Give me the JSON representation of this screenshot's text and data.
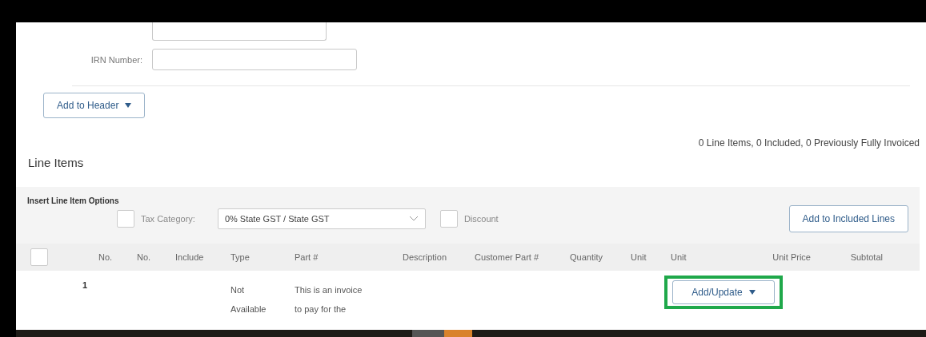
{
  "header_form": {
    "irn_label": "IRN Number:",
    "add_to_header": "Add to Header"
  },
  "line_items": {
    "title": "Line Items",
    "summary": "0 Line Items,  0 Included,  0 Previously Fully Invoiced"
  },
  "insert_options": {
    "title": "Insert Line Item Options",
    "tax_category": {
      "checked": false,
      "label": "Tax Category:",
      "value": "0% State GST / State GST"
    },
    "discount": {
      "checked": false,
      "label": "Discount"
    },
    "add_button": "Add to Included Lines"
  },
  "table": {
    "select_all_checked": false,
    "columns": [
      "No.",
      "No.",
      "Include",
      "Type",
      "Part #",
      "Description",
      "Customer Part #",
      "Quantity",
      "Unit",
      "Unit",
      "Unit Price",
      "Subtotal"
    ],
    "rows": [
      {
        "number": "1",
        "type_lines": [
          "Not",
          "Available"
        ],
        "part_lines": [
          "This is an invoice",
          "to pay for the"
        ],
        "action": "Add/Update",
        "highlighted": true
      }
    ]
  }
}
